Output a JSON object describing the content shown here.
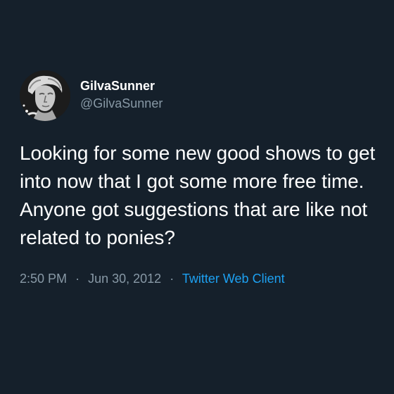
{
  "user": {
    "display_name": "GilvaSunner",
    "handle": "@GilvaSunner",
    "avatar_icon": "statue-avatar"
  },
  "tweet": {
    "text": "Looking for some new good shows to get into now that I got some more free time. Anyone got suggestions that are like not related to ponies?",
    "time": "2:50 PM",
    "date": "Jun 30, 2012",
    "separator": "·",
    "client": "Twitter Web Client"
  },
  "colors": {
    "background": "#15202b",
    "text": "#ffffff",
    "secondary": "#8899a6",
    "link": "#1da1f2"
  }
}
